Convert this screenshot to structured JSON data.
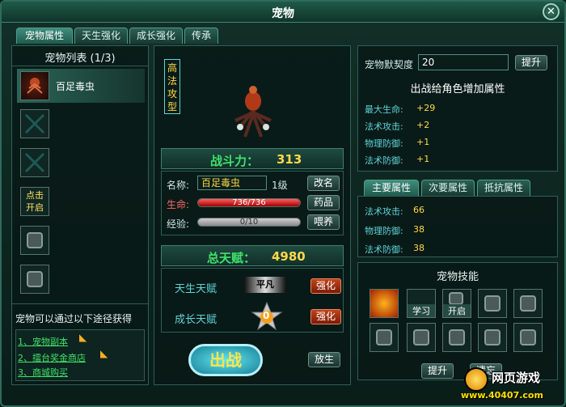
{
  "window": {
    "title": "宠物",
    "close": "✕"
  },
  "tabs": [
    "宠物属性",
    "天生强化",
    "成长强化",
    "传承"
  ],
  "pet_list": {
    "title": "宠物列表 (1/3)",
    "items": [
      {
        "name": "百足毒虫"
      },
      {
        "name": ""
      },
      {
        "name": ""
      },
      {
        "name": "点击\n开启",
        "unlock": true
      },
      {
        "name": ""
      },
      {
        "name": ""
      }
    ]
  },
  "source": {
    "title": "宠物可以通过以下途径获得",
    "items": [
      "1、宠物副本",
      "2、擂台奖金商店",
      "3、商城购买"
    ]
  },
  "pet": {
    "type_badge": "高\n法\n攻\n型",
    "power_label": "战斗力：",
    "power": "313",
    "name_label": "名称:",
    "name": "百足毒虫",
    "level": "1级",
    "rename": "改名",
    "hp_label": "生命:",
    "hp": "736/736",
    "hp_fraction": 1.0,
    "potion": "药品",
    "exp_label": "经验:",
    "exp": "0/10",
    "exp_fraction": 0.0,
    "feed": "喂养"
  },
  "talent": {
    "total_label": "总天赋：",
    "total": "4980",
    "born_label": "天生天赋",
    "born_grade": "平凡",
    "strengthen": "强化",
    "growth_label": "成长天赋",
    "growth_value": "0"
  },
  "actions": {
    "fight": "出战",
    "release": "放生"
  },
  "bond": {
    "label": "宠物默契度",
    "value": "20",
    "raise": "提升"
  },
  "bonus": {
    "title": "出战给角色增加属性",
    "rows": [
      {
        "k": "最大生命:",
        "v": "+29"
      },
      {
        "k": "法术攻击:",
        "v": "+2"
      },
      {
        "k": "物理防御:",
        "v": "+1"
      },
      {
        "k": "法术防御:",
        "v": "+1"
      }
    ]
  },
  "attr_tabs": [
    "主要属性",
    "次要属性",
    "抵抗属性"
  ],
  "attrs": [
    {
      "k": "法术攻击:",
      "v": "66"
    },
    {
      "k": "物理防御:",
      "v": "38"
    },
    {
      "k": "法术防御:",
      "v": "38"
    }
  ],
  "skills": {
    "title": "宠物技能",
    "learn": "学习",
    "open": "开启",
    "raise": "提升",
    "forget": "遗忘"
  },
  "watermark": {
    "brand": "网页游戏",
    "url": "www.40407.com"
  },
  "colors": {
    "accent": "#5fd4d9",
    "gold": "#ffd84a",
    "green": "#3fe26a"
  }
}
